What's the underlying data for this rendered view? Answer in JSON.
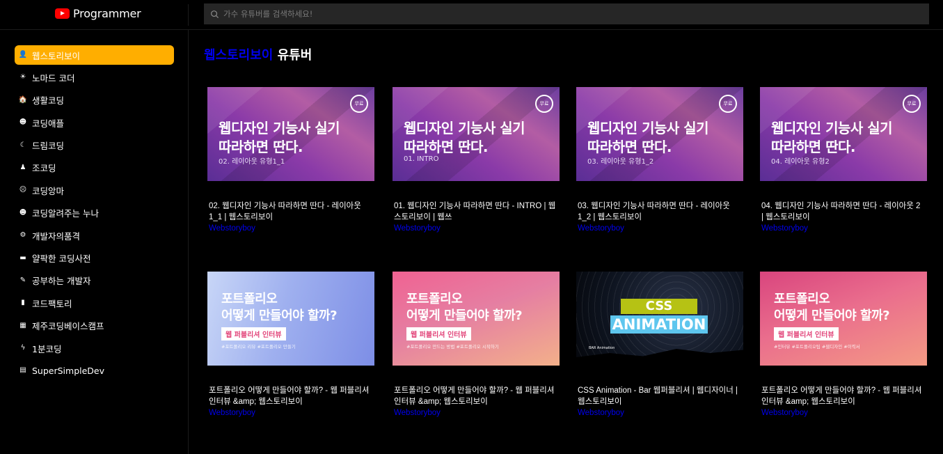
{
  "header": {
    "logo_text": "Programmer",
    "search_placeholder": "가수 유튜버를 검색하세요!"
  },
  "sidebar": {
    "items": [
      {
        "label": "웹스토리보이",
        "icon": "user-icon",
        "glyph": "👤",
        "active": true
      },
      {
        "label": "노마드 코더",
        "icon": "sun-icon",
        "glyph": "☀",
        "active": false
      },
      {
        "label": "생활코딩",
        "icon": "house-icon",
        "glyph": "🏠",
        "active": false
      },
      {
        "label": "코딩애플",
        "icon": "smile-icon",
        "glyph": "☻",
        "active": false
      },
      {
        "label": "드림코딩",
        "icon": "moon-icon",
        "glyph": "☾",
        "active": false
      },
      {
        "label": "조코딩",
        "icon": "person-icon",
        "glyph": "♟",
        "active": false
      },
      {
        "label": "코딩앙마",
        "icon": "frown-icon",
        "glyph": "☹",
        "active": false
      },
      {
        "label": "코딩알려주는 누나",
        "icon": "grin-icon",
        "glyph": "☻",
        "active": false
      },
      {
        "label": "개발자의품격",
        "icon": "gear-icon",
        "glyph": "⚙",
        "active": false
      },
      {
        "label": "얄팍한 코딩사전",
        "icon": "book-icon",
        "glyph": "▬",
        "active": false
      },
      {
        "label": "공부하는 개발자",
        "icon": "pencil-icon",
        "glyph": "✎",
        "active": false
      },
      {
        "label": "코드팩토리",
        "icon": "file-icon",
        "glyph": "▮",
        "active": false
      },
      {
        "label": "제주코딩베이스캠프",
        "icon": "gift-icon",
        "glyph": "▦",
        "active": false
      },
      {
        "label": "1분코딩",
        "icon": "bolt-icon",
        "glyph": "ϟ",
        "active": false
      },
      {
        "label": "SuperSimpleDev",
        "icon": "calculator-icon",
        "glyph": "▤",
        "active": false
      }
    ]
  },
  "main": {
    "title_highlight": "웹스토리보이",
    "title_rest": " 유튜버",
    "videos": [
      {
        "thumb_style": "purple",
        "thumb_line1": "웹디자인 기능사 실기",
        "thumb_line2": "따라하면 딴다.",
        "thumb_sub": "02. 레이아웃 유형1_1",
        "badge": "무료",
        "title": "02. 웹디자인 기능사 따라하면 딴다 - 레이아웃 1_1 | 웹스토리보이",
        "channel": "Webstoryboy"
      },
      {
        "thumb_style": "purple",
        "thumb_line1": "웹디자인 기능사 실기",
        "thumb_line2": "따라하면 딴다.",
        "thumb_sub": "01. INTRO",
        "badge": "무료",
        "title": "01. 웹디자인 기능사 따라하면 딴다 - INTRO | 웹스토리보이 | 웹쓰",
        "channel": "Webstoryboy"
      },
      {
        "thumb_style": "purple",
        "thumb_line1": "웹디자인 기능사 실기",
        "thumb_line2": "따라하면 딴다.",
        "thumb_sub": "03. 레이아웃 유형1_2",
        "badge": "무료",
        "title": "03. 웹디자인 기능사 따라하면 딴다 - 레이아웃 1_2 | 웹스토리보이",
        "channel": "Webstoryboy"
      },
      {
        "thumb_style": "purple",
        "thumb_line1": "웹디자인 기능사 실기",
        "thumb_line2": "따라하면 딴다.",
        "thumb_sub": "04. 레이아웃 유형2",
        "badge": "무료",
        "title": "04. 웹디자인 기능사 따라하면 딴다 - 레이아웃 2 | 웹스토리보이",
        "channel": "Webstoryboy"
      },
      {
        "thumb_style": "blue",
        "thumb_line1": "포트폴리오",
        "thumb_line2": "어떻게 만들어야 할까?",
        "pill": "웹 퍼블리셔 인터뷰",
        "thumb_sub": "#포트폴리오 리뷰 #포트폴리오 만들기",
        "title": "포트폴리오 어떻게 만들어야 할까? - 웹 퍼블리셔 인터뷰 &amp; 웹스토리보이",
        "channel": "Webstoryboy"
      },
      {
        "thumb_style": "pink",
        "thumb_line1": "포트폴리오",
        "thumb_line2": "어떻게 만들어야 할까?",
        "pill": "웹 퍼블리셔 인터뷰",
        "thumb_sub": "#포트폴리오 만드는 방법 #포트폴리오 시작하기",
        "title": "포트폴리오 어떻게 만들어야 할까? - 웹 퍼블리셔 인터뷰 &amp; 웹스토리보이",
        "channel": "Webstoryboy"
      },
      {
        "thumb_style": "css",
        "thumb_line1": "CSS",
        "thumb_line2": "ANIMATION",
        "thumb_sub": "BAR Animation",
        "title": "CSS Animation - Bar 웹퍼블리셔 | 웹디자이너 | 웹스토리보이",
        "channel": "Webstoryboy"
      },
      {
        "thumb_style": "pink2",
        "thumb_line1": "포트폴리오",
        "thumb_line2": "어떻게 만들어야 할까?",
        "pill": "웹 퍼블리셔 인터뷰",
        "thumb_sub": "#인터뷰 #포트폴리오팁 #웹디자인 #이력서",
        "title": "포트폴리오 어떻게 만들어야 할까? - 웹 퍼블리셔 인터뷰 &amp; 웹스토리보이",
        "channel": "Webstoryboy"
      }
    ]
  }
}
